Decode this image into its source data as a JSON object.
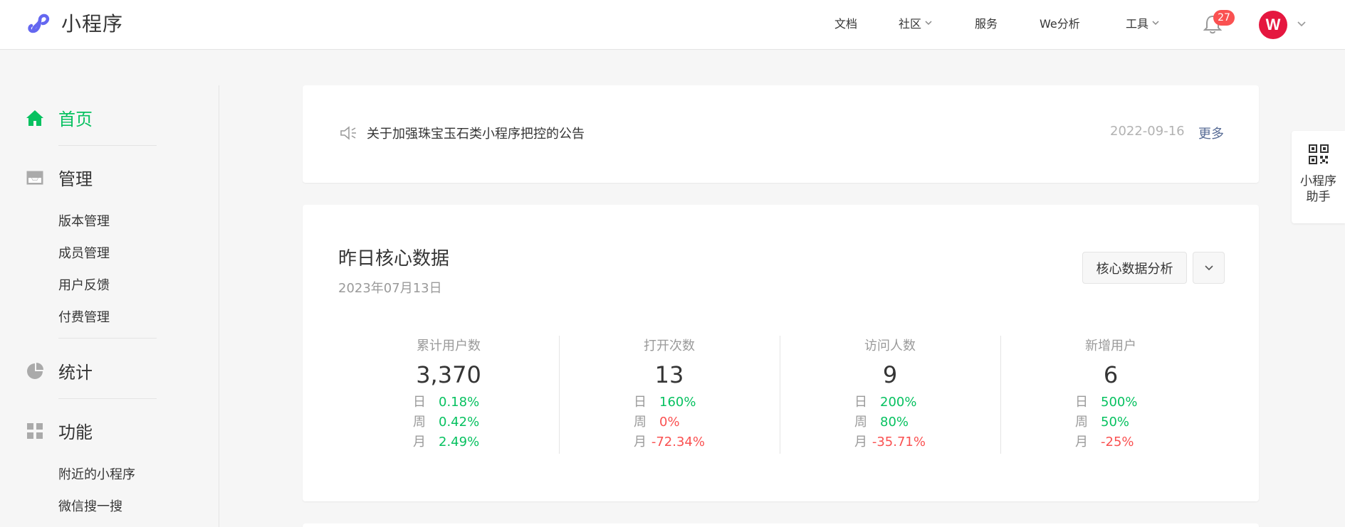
{
  "header": {
    "logo_text": "小程序",
    "nav": [
      {
        "label": "文档",
        "has_dropdown": false
      },
      {
        "label": "社区",
        "has_dropdown": true
      },
      {
        "label": "服务",
        "has_dropdown": false
      },
      {
        "label": "We分析",
        "has_dropdown": false
      },
      {
        "label": "工具",
        "has_dropdown": true
      }
    ],
    "notification_count": "27",
    "avatar_letter": "W"
  },
  "sidebar": {
    "home": "首页",
    "manage": "管理",
    "manage_items": [
      "版本管理",
      "成员管理",
      "用户反馈",
      "付费管理"
    ],
    "stats": "统计",
    "features": "功能",
    "feature_items": [
      "附近的小程序",
      "微信搜一搜"
    ]
  },
  "notice": {
    "text": "关于加强珠宝玉石类小程序把控的公告",
    "date": "2022-09-16",
    "more": "更多"
  },
  "core": {
    "title": "昨日核心数据",
    "date": "2023年07月13日",
    "analysis_button": "核心数据分析",
    "metrics": [
      {
        "label": "累计用户数",
        "value": "3,370",
        "rows": [
          {
            "period": "日",
            "change": "0.18%",
            "trend": "up"
          },
          {
            "period": "周",
            "change": "0.42%",
            "trend": "up"
          },
          {
            "period": "月",
            "change": "2.49%",
            "trend": "up"
          }
        ]
      },
      {
        "label": "打开次数",
        "value": "13",
        "rows": [
          {
            "period": "日",
            "change": "160%",
            "trend": "up"
          },
          {
            "period": "周",
            "change": "0%",
            "trend": "down"
          },
          {
            "period": "月",
            "change": "-72.34%",
            "trend": "down"
          }
        ]
      },
      {
        "label": "访问人数",
        "value": "9",
        "rows": [
          {
            "period": "日",
            "change": "200%",
            "trend": "up"
          },
          {
            "period": "周",
            "change": "80%",
            "trend": "up"
          },
          {
            "period": "月",
            "change": "-35.71%",
            "trend": "down"
          }
        ]
      },
      {
        "label": "新增用户",
        "value": "6",
        "rows": [
          {
            "period": "日",
            "change": "500%",
            "trend": "up"
          },
          {
            "period": "周",
            "change": "50%",
            "trend": "up"
          },
          {
            "period": "月",
            "change": "-25%",
            "trend": "down"
          }
        ]
      }
    ]
  },
  "helper": {
    "line1": "小程序",
    "line2": "助手"
  },
  "colors": {
    "accent_green": "#07c160",
    "negative_red": "#fa5151",
    "link_blue": "#576b95"
  }
}
